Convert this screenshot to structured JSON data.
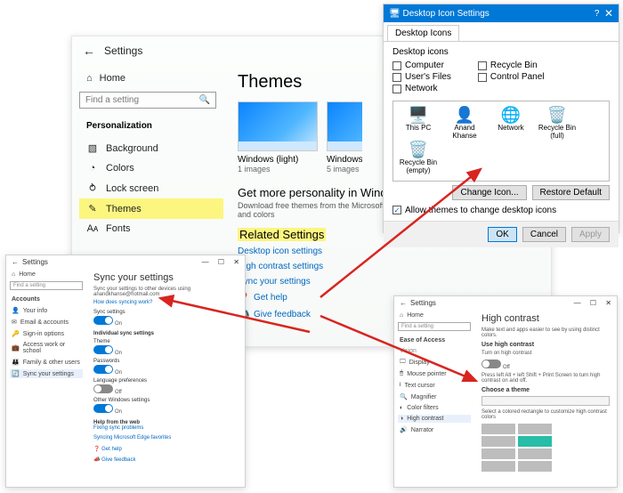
{
  "main": {
    "appTitle": "Settings",
    "home": "Home",
    "searchPlaceholder": "Find a setting",
    "category": "Personalization",
    "side": [
      {
        "icon": "▧",
        "label": "Background"
      },
      {
        "icon": "◔",
        "label": "Colors"
      },
      {
        "icon": "⥁",
        "label": "Lock screen"
      },
      {
        "icon": "✎",
        "label": "Themes"
      },
      {
        "icon": "Aᴀ",
        "label": "Fonts"
      }
    ],
    "pageTitle": "Themes",
    "themes": [
      {
        "name": "Windows (light)",
        "count": "1 images"
      },
      {
        "name": "Windows",
        "count": "5 images"
      }
    ],
    "moreTitle": "Get more personality in Windows",
    "moreDesc": "Download free themes from the Microsoft Store that combine wallpapers, sounds, and colors",
    "relatedHeading": "Related Settings",
    "links": [
      "Desktop icon settings",
      "High contrast settings",
      "Sync your settings"
    ],
    "help": "Get help",
    "feedback": "Give feedback"
  },
  "dlg": {
    "title": "Desktop Icon Settings",
    "tab": "Desktop Icons",
    "groupLabel": "Desktop icons",
    "left": [
      "Computer",
      "User's Files",
      "Network"
    ],
    "right": [
      "Recycle Bin",
      "Control Panel"
    ],
    "icons": [
      {
        "g": "🖥️",
        "n": "This PC"
      },
      {
        "g": "👤",
        "n": "Anand Khanse"
      },
      {
        "g": "🌐",
        "n": "Network"
      },
      {
        "g": "🗑️",
        "n": "Recycle Bin (full)"
      },
      {
        "g": "🗑️",
        "n": "Recycle Bin (empty)"
      }
    ],
    "changeIcon": "Change Icon...",
    "restore": "Restore Default",
    "allow": "Allow themes to change desktop icons",
    "ok": "OK",
    "cancel": "Cancel",
    "apply": "Apply"
  },
  "sync": {
    "appTitle": "Settings",
    "home": "Home",
    "searchPlaceholder": "Find a setting",
    "category": "Accounts",
    "side": [
      "Your info",
      "Email & accounts",
      "Sign-in options",
      "Access work or school",
      "Family & other users",
      "Sync your settings"
    ],
    "pageTitle": "Sync your settings",
    "desc": "Sync your settings to other devices using anandkhanse@hotmail.com",
    "howLink": "How does syncing work?",
    "syncLabel": "Sync settings",
    "on": "On",
    "off": "Off",
    "indHeading": "Individual sync settings",
    "items": [
      {
        "label": "Theme",
        "state": "On",
        "on": true
      },
      {
        "label": "Passwords",
        "state": "On",
        "on": true
      },
      {
        "label": "Language preferences",
        "state": "Off",
        "on": false
      },
      {
        "label": "Other Windows settings",
        "state": "On",
        "on": true
      }
    ],
    "helpHead": "Help from the web",
    "help1": "Fixing sync problems",
    "help2": "Syncing Microsoft Edge favorites",
    "getHelp": "Get help",
    "giveFeedback": "Give feedback"
  },
  "hc": {
    "appTitle": "Settings",
    "home": "Home",
    "searchPlaceholder": "Find a setting",
    "category": "Ease of Access",
    "sideGroups": {
      "vision": "Vision",
      "items": [
        "Display",
        "Mouse pointer",
        "Text cursor",
        "Magnifier",
        "Color filters",
        "High contrast",
        "Narrator"
      ]
    },
    "pageTitle": "High contrast",
    "desc": "Make text and apps easier to see by using distinct colors.",
    "useHead": "Use high contrast",
    "turnOn": "Turn on high contrast",
    "off": "Off",
    "hint": "Press left Alt + left Shift + Print Screen to turn high contrast on and off.",
    "choose": "Choose a theme",
    "selectHint": "Select a colored rectangle to customize high contrast colors"
  }
}
